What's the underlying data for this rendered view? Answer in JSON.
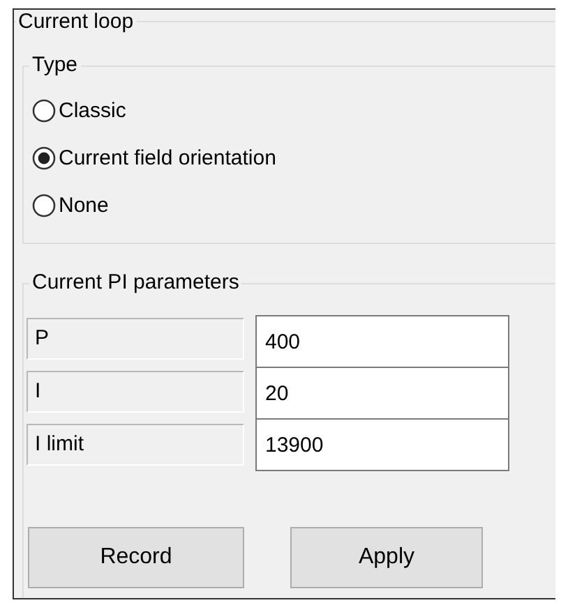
{
  "group": {
    "title": "Current loop"
  },
  "type_group": {
    "title": "Type",
    "options": [
      {
        "label": "Classic",
        "selected": false
      },
      {
        "label": "Current field orientation",
        "selected": true
      },
      {
        "label": "None",
        "selected": false
      }
    ]
  },
  "pi_group": {
    "title": "Current PI parameters",
    "params": [
      {
        "label": "P",
        "value": "400"
      },
      {
        "label": "I",
        "value": "20"
      },
      {
        "label": "I limit",
        "value": "13900"
      }
    ]
  },
  "buttons": [
    "Record",
    "Apply"
  ]
}
